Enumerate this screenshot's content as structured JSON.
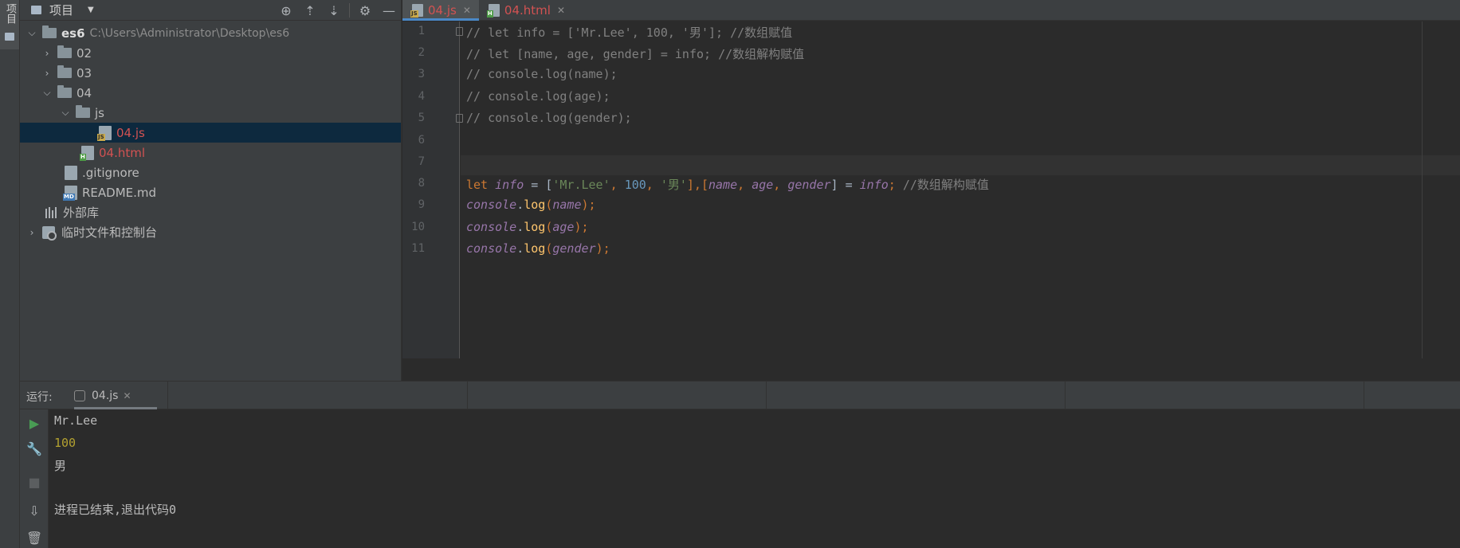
{
  "project_panel": {
    "side_tab_label": "项目",
    "title": "项目",
    "tree": [
      {
        "label": "es6",
        "path": "C:\\Users\\Administrator\\Desktop\\es6",
        "type": "folder",
        "expanded": true
      },
      {
        "label": "02",
        "type": "folder",
        "expanded": false
      },
      {
        "label": "03",
        "type": "folder",
        "expanded": false
      },
      {
        "label": "04",
        "type": "folder",
        "expanded": true
      },
      {
        "label": "js",
        "type": "folder",
        "expanded": true
      },
      {
        "label": "04.js",
        "type": "file-js",
        "selected": true
      },
      {
        "label": "04.html",
        "type": "file-html"
      },
      {
        "label": ".gitignore",
        "type": "file-ignore"
      },
      {
        "label": "README.md",
        "type": "file-md"
      },
      {
        "label": "外部库",
        "type": "library"
      },
      {
        "label": "临时文件和控制台",
        "type": "scratches",
        "expanded": false
      }
    ]
  },
  "editor_tabs": [
    {
      "label": "04.js",
      "active": true,
      "icon": "js-file-icon"
    },
    {
      "label": "04.html",
      "active": false,
      "icon": "html-file-icon"
    }
  ],
  "editor": {
    "line_numbers": [
      "1",
      "2",
      "3",
      "4",
      "5",
      "6",
      "7",
      "8",
      "9",
      "10",
      "11"
    ],
    "lines": {
      "l1": "// let info = ['Mr.Lee', 100, '男']; //数组赋值",
      "l2": "// let [name, age, gender] = info; //数组解构赋值",
      "l3": "// console.log(name);",
      "l4": "// console.log(age);",
      "l5": "// console.log(gender);",
      "l8": {
        "kw": "let",
        "var_info": "info",
        "eq": " = [",
        "s1": "'Mr.Lee'",
        "c1": ", ",
        "n1": "100",
        "c2": ", ",
        "s2": "'男'",
        "br": "],[",
        "v_name": "name",
        "c3": ", ",
        "v_age": "age",
        "c4": ", ",
        "v_gender": "gender",
        "eq2": "] = ",
        "v_info2": "info",
        "semi": ";",
        "comment": " //数组解构赋值"
      },
      "l9": {
        "obj": "console",
        "dot": ".",
        "fn": "log",
        "open": "(",
        "arg": "name",
        "close": ")",
        "semi": ";"
      },
      "l10": {
        "obj": "console",
        "dot": ".",
        "fn": "log",
        "open": "(",
        "arg": "age",
        "close": ")",
        "semi": ";"
      },
      "l11": {
        "obj": "console",
        "dot": ".",
        "fn": "log",
        "open": "(",
        "arg": "gender",
        "close": ")",
        "semi": ";"
      }
    }
  },
  "run_window": {
    "label": "运行:",
    "tab_label": "04.js",
    "output": [
      "Mr.Lee",
      "100",
      "男",
      "",
      "进程已结束,退出代码0"
    ]
  },
  "colors": {
    "accent": "#4a88c7",
    "modified_file": "#d25252",
    "keyword": "#cc7832",
    "string": "#6a8759",
    "number": "#6897bb",
    "variable": "#9876aa",
    "function": "#ffc66d",
    "comment": "#808080"
  }
}
